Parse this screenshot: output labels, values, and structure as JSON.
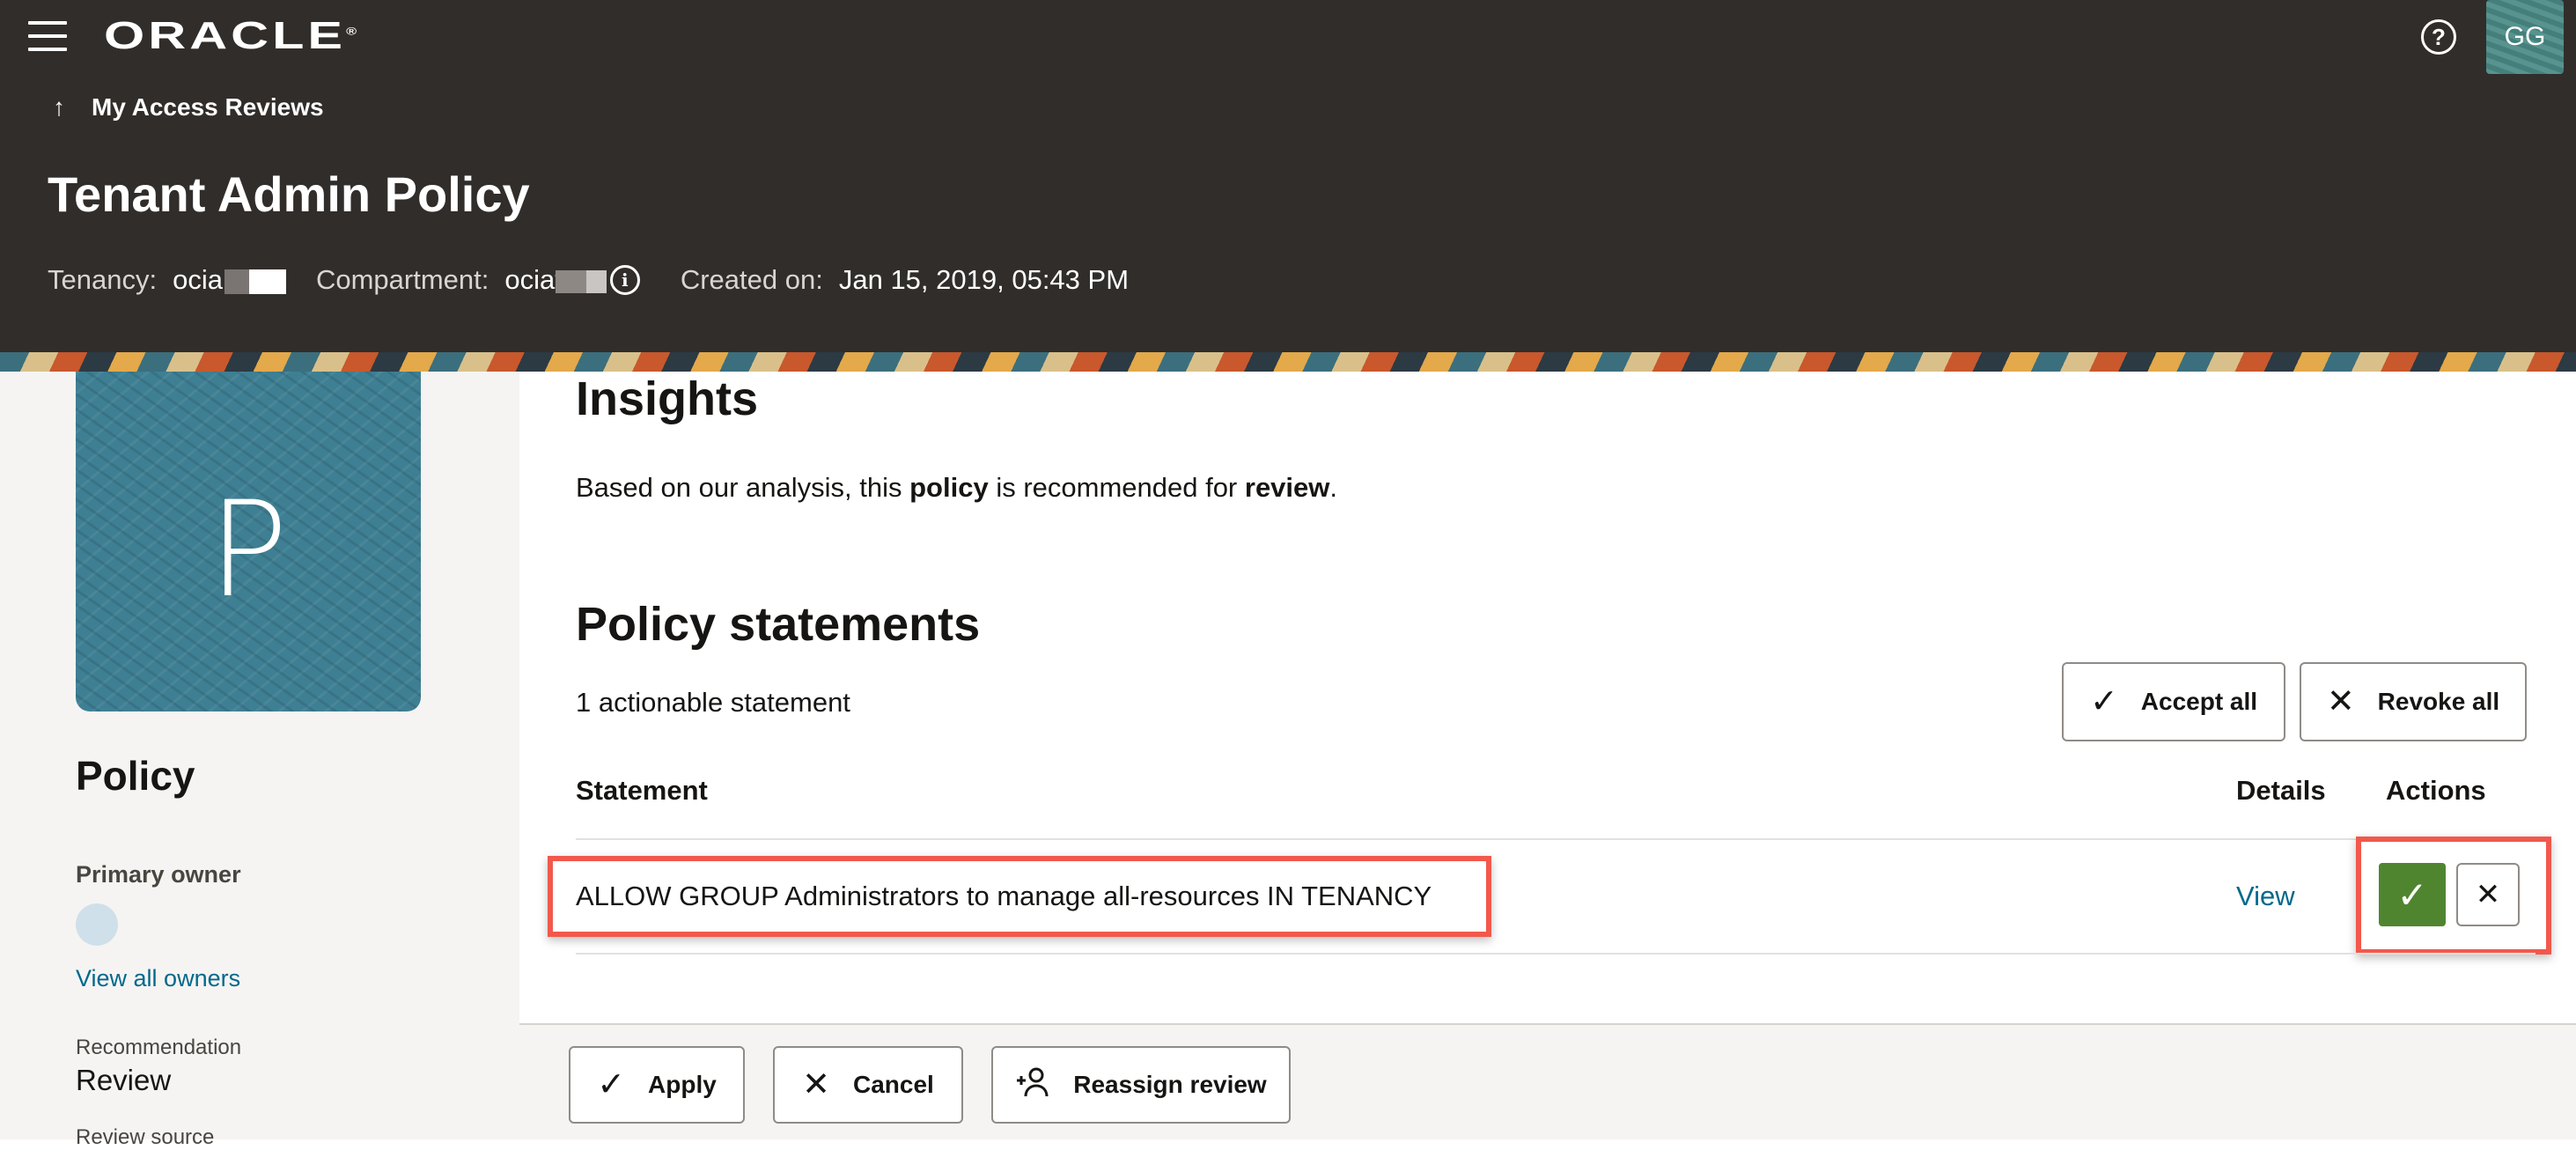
{
  "header": {
    "logo": "ORACLE",
    "logo_reg": "®",
    "help_glyph": "?",
    "avatar_initials": "GG",
    "back_link": "My Access Reviews",
    "page_title": "Tenant Admin Policy",
    "tenancy_label": "Tenancy:",
    "tenancy_value": "ocia",
    "compartment_label": "Compartment:",
    "compartment_value": "ociat",
    "created_label": "Created on:",
    "created_value": "Jan 15, 2019, 05:43 PM"
  },
  "sidebar": {
    "tile_letter": "P",
    "title": "Policy",
    "primary_owner_label": "Primary owner",
    "view_all_owners": "View all owners",
    "recommendation_label": "Recommendation",
    "recommendation_value": "Review",
    "review_source_label": "Review source"
  },
  "main": {
    "insights_title": "Insights",
    "insight_pre": "Based on our analysis, this ",
    "insight_b1": "policy",
    "insight_mid": " is recommended for ",
    "insight_b2": "review",
    "insight_end": ".",
    "policy_title": "Policy statements",
    "count_text": "1 actionable statement",
    "accept_all": "Accept all",
    "revoke_all": "Revoke all",
    "columns": [
      "Statement",
      "Details",
      "Actions"
    ],
    "rows": [
      {
        "statement": "ALLOW GROUP Administrators to manage all-resources IN TENANCY",
        "details": "View"
      }
    ]
  },
  "footer": {
    "apply": "Apply",
    "cancel": "Cancel",
    "reassign": "Reassign review"
  },
  "colors": {
    "header_bg": "#312d2a",
    "accept_green": "#508530",
    "highlight_red": "#f2584b",
    "link_teal": "#00688c"
  },
  "icons": {
    "menu": "hamburger-menu-icon",
    "help": "help-circle-icon",
    "back": "arrow-up-icon",
    "info": "info-icon",
    "check": "check-icon",
    "close": "close-icon",
    "reassign": "person-reassign-icon"
  }
}
